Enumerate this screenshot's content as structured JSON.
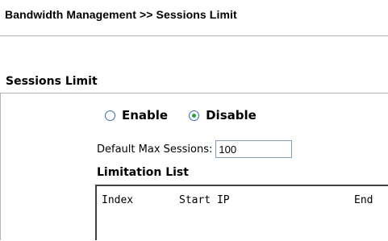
{
  "page": {
    "title": "Bandwidth Management >> Sessions Limit"
  },
  "section": {
    "title": "Sessions Limit"
  },
  "mode": {
    "options": [
      {
        "label": "Enable",
        "checked": false
      },
      {
        "label": "Disable",
        "checked": true
      }
    ]
  },
  "default_max_sessions": {
    "label": "Default Max Sessions:",
    "value": "100"
  },
  "limitation_list": {
    "title": "Limitation List",
    "columns": [
      "Index",
      "Start IP",
      "End"
    ]
  }
}
